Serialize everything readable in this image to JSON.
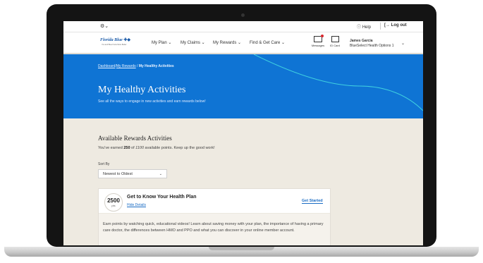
{
  "utility_bar": {
    "settings_icon": "gear-icon",
    "settings_caret": "⌄",
    "help": "Help",
    "help_icon": "question-circle-icon",
    "logout": "Log out",
    "logout_icon": "logout-icon"
  },
  "nav": {
    "logo_text": "Florida Blue",
    "logo_tagline": "You and Blue Know More Better",
    "items": [
      "My Plan ⌄",
      "My Claims ⌄",
      "My Rewards ⌄",
      "Find & Get Care ⌄"
    ],
    "messages_label": "Messages",
    "id_card_label": "ID Card",
    "user_name": "James Garcia",
    "user_plan": "BlueSelect Health Options 1",
    "user_caret": "⌄"
  },
  "hero": {
    "breadcrumb_dashboard": "Dashboard",
    "breadcrumb_rewards": "My Rewards",
    "breadcrumb_separator": " / ",
    "breadcrumb_current": "My Healthy Activities",
    "title": "My Healthy Activities",
    "subtitle": "See all the ways to engage in new activities and earn rewards below!"
  },
  "rewards": {
    "section_title": "Available Rewards Activities",
    "points_prefix": "You've earned ",
    "points_earned": "250",
    "points_of": " of ",
    "points_available": "1100",
    "points_suffix": " available points. Keep up the good work!",
    "sort_label": "Sort By",
    "sort_value": "Newest to Oldest",
    "sort_caret": "⌄"
  },
  "activity": {
    "points": "2500",
    "points_unit": "pts",
    "title": "Get to Know Your Health Plan",
    "hide_details": "Hide Details",
    "cta": "Get Started",
    "description": "Earn points by watching quick, educational videos! Learn about saving money with your plan, the importance of having a primary care doctor, the differences between HMO and PPO and what you can discover in your online member account."
  },
  "colors": {
    "hero_blue": "#0f74d4",
    "brand_blue": "#1a5aa8",
    "link_blue": "#1a6cc4",
    "content_bg": "#eeeae1",
    "curve_cyan": "#3fd0e0"
  }
}
